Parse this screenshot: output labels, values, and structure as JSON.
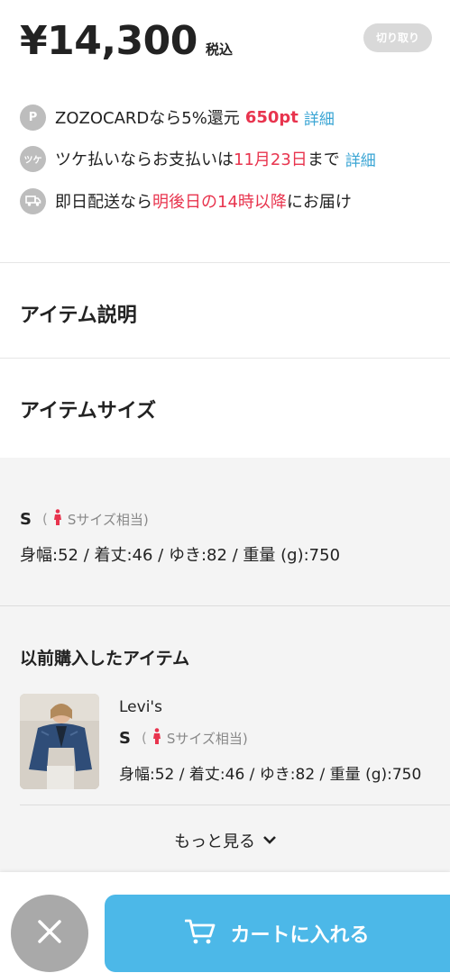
{
  "price": {
    "amount": "¥14,300",
    "tax_label": "税込",
    "cut_label": "切り取り"
  },
  "info": {
    "zozocard": {
      "icon_letter": "P",
      "text_prefix": "ZOZOCARDなら5%還元",
      "points": "650pt",
      "link": "詳細"
    },
    "tsuke": {
      "icon_text": "ツケ",
      "text_prefix": "ツケ払いならお支払いは",
      "date": "11月23日",
      "text_suffix": "まで",
      "link": "詳細"
    },
    "delivery": {
      "text_prefix": "即日配送なら",
      "highlight": "明後日の14時以降",
      "text_suffix": "にお届け"
    }
  },
  "sections": {
    "description_title": "アイテム説明",
    "size_title": "アイテムサイズ"
  },
  "size": {
    "letter": "S",
    "paren_open": "(",
    "equivalent": "Sサイズ相当)",
    "measurements": "身幅:52 / 着丈:46 / ゆき:82 / 重量 (g):750"
  },
  "previous": {
    "title": "以前購入したアイテム",
    "brand": "Levi's",
    "size_letter": "S",
    "paren_open": "(",
    "equivalent": "Sサイズ相当)",
    "measurements": "身幅:52 / 着丈:46 / ゆき:82 / 重量 (g):750"
  },
  "more_label": "もっと見る",
  "cart": {
    "label": "カートに入れる"
  },
  "colors": {
    "accent_red": "#e8344e",
    "link_blue": "#3aa5d4",
    "cart_blue": "#4cb8e8"
  }
}
